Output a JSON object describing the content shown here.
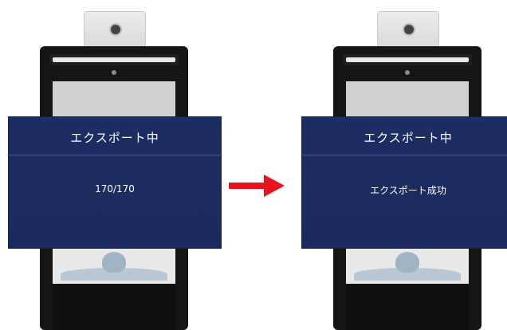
{
  "left_panel": {
    "dialog_title": "エクスポート中",
    "dialog_message": "170/170"
  },
  "right_panel": {
    "dialog_title": "エクスポート中",
    "dialog_message": "エクスポート成功"
  },
  "arrow": {
    "color": "#e8131b",
    "icon": "arrow-right-icon"
  },
  "dialog_color": "#1d2c63"
}
